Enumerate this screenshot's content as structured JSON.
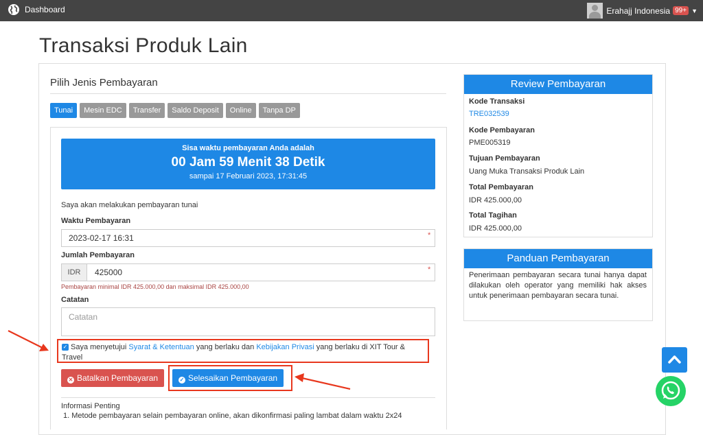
{
  "topbar": {
    "brand": "Dashboard",
    "user": "Erahajj Indonesia",
    "badge": "99+"
  },
  "page": {
    "title": "Transaksi Produk Lain"
  },
  "payment": {
    "section_title": "Pilih Jenis Pembayaran",
    "tabs": [
      "Tunai",
      "Mesin EDC",
      "Transfer",
      "Saldo Deposit",
      "Online",
      "Tanpa DP"
    ],
    "active_tab": "Tunai",
    "timer": {
      "line1": "Sisa waktu pembayaran Anda adalah",
      "line2": "00 Jam 59 Menit 38 Detik",
      "line3": "sampai 17 Februari 2023, 17:31:45"
    },
    "intro": "Saya akan melakukan pembayaran tunai",
    "waktu_label": "Waktu Pembayaran",
    "waktu_value": "2023-02-17 16:31",
    "jumlah_label": "Jumlah Pembayaran",
    "currency": "IDR",
    "jumlah_value": "425000",
    "jumlah_help": "Pembayaran minimal IDR 425.000,00 dan maksimal IDR 425.000,00",
    "catatan_label": "Catatan",
    "catatan_placeholder": "Catatan",
    "agree_part1": "Saya menyetujui",
    "agree_link1": "Syarat & Ketentuan",
    "agree_part2": "yang berlaku dan",
    "agree_link2": "Kebijakan Privasi",
    "agree_part3": "yang berlaku di XIT Tour & Travel",
    "agree_checked": true,
    "cancel_label": "Batalkan Pembayaran",
    "finish_label": "Selesaikan Pembayaran",
    "info_title": "Informasi Penting",
    "info_item1": "1. Metode pembayaran selain pembayaran online, akan dikonfirmasi paling lambat dalam waktu 2x24"
  },
  "review": {
    "title": "Review Pembayaran",
    "kode_transaksi_label": "Kode Transaksi",
    "kode_transaksi": "TRE032539",
    "kode_pembayaran_label": "Kode Pembayaran",
    "kode_pembayaran": "PME005319",
    "tujuan_label": "Tujuan Pembayaran",
    "tujuan": "Uang Muka Transaksi Produk Lain",
    "total_pembayaran_label": "Total Pembayaran",
    "total_pembayaran": "IDR 425.000,00",
    "total_tagihan_label": "Total Tagihan",
    "total_tagihan": "IDR 425.000,00"
  },
  "guide": {
    "title": "Panduan Pembayaran",
    "text": "Penerimaan pembayaran secara tunai hanya dapat dilakukan oleh operator yang memiliki hak akses untuk penerimaan pembayaran secara tunai."
  },
  "colors": {
    "primary": "#1e88e5",
    "danger": "#d9534f",
    "annotation": "#e8371d",
    "topbar": "#444444",
    "whatsapp": "#25d366"
  },
  "icons": [
    "globe-icon",
    "check-circle-icon",
    "times-circle-icon",
    "chevron-up-icon",
    "whatsapp-icon"
  ]
}
